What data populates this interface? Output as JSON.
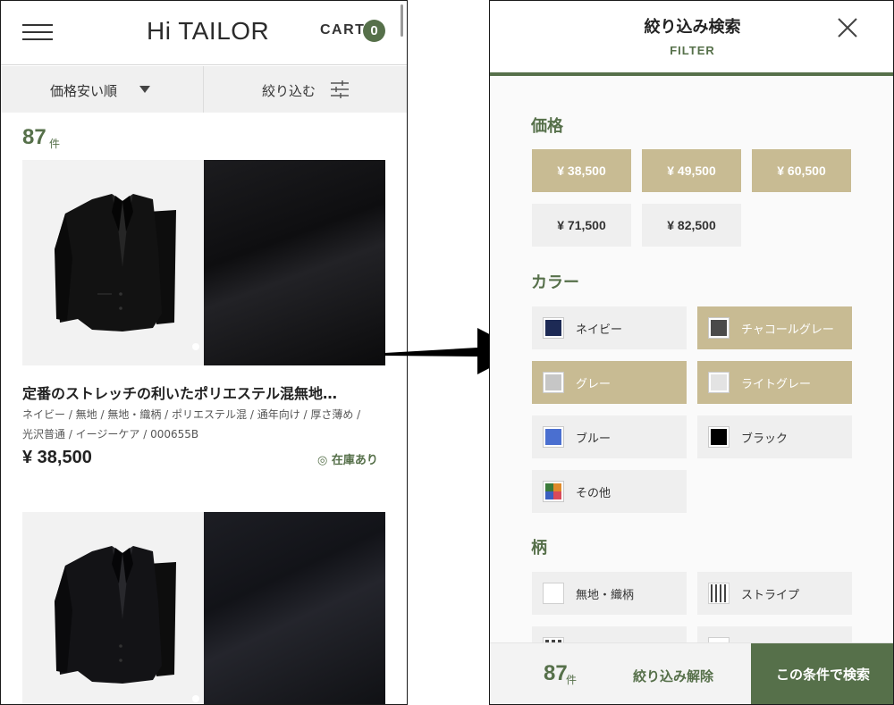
{
  "list_screen": {
    "brand": "Hi TAILOR",
    "cart_label": "CART",
    "cart_count": "0",
    "sort_label": "価格安い順",
    "filter_label": "絞り込む",
    "result_count": "87",
    "result_unit": "件",
    "products": [
      {
        "title": "定番のストレッチの利いたポリエステル混無地…",
        "tags_line1": "ネイビー / 無地 / 無地・織柄 / ポリエステル混 / 通年向け / 厚さ薄め /",
        "tags_line2": "光沢普通 / イージーケア / 000655B",
        "price": "¥ 38,500",
        "stock": "◎ 在庫あり"
      },
      {
        "title": "",
        "tags_line1": "",
        "tags_line2": "",
        "price": "",
        "stock": ""
      }
    ]
  },
  "filter_screen": {
    "title": "絞り込み検索",
    "subtitle": "FILTER",
    "sections": {
      "price": "価格",
      "color": "カラー",
      "pattern": "柄"
    },
    "prices": [
      {
        "label": "¥ 38,500",
        "selected": true
      },
      {
        "label": "¥ 49,500",
        "selected": true
      },
      {
        "label": "¥ 60,500",
        "selected": true
      },
      {
        "label": "¥ 71,500",
        "selected": false
      },
      {
        "label": "¥ 82,500",
        "selected": false
      }
    ],
    "colors": [
      {
        "label": "ネイビー",
        "swatch": "#1d2a55",
        "selected": false
      },
      {
        "label": "チャコールグレー",
        "swatch": "#4a4a4a",
        "selected": true
      },
      {
        "label": "グレー",
        "swatch": "#c6c6c6",
        "selected": true
      },
      {
        "label": "ライトグレー",
        "swatch": "#e3e3e3",
        "selected": true
      },
      {
        "label": "ブルー",
        "swatch": "#4a6fd0",
        "selected": false
      },
      {
        "label": "ブラック",
        "swatch": "#000000",
        "selected": false
      },
      {
        "label": "その他",
        "swatch": "multi",
        "selected": false
      }
    ],
    "other_swatch_colors": [
      "#3a7a3a",
      "#e08a2a",
      "#3a5fc0",
      "#d84a5a"
    ],
    "patterns": [
      {
        "label": "無地・織柄",
        "icon": "plain-icon"
      },
      {
        "label": "ストライプ",
        "icon": "stripe-icon"
      }
    ],
    "footer": {
      "count": "87",
      "unit": "件",
      "clear_label": "絞り込み解除",
      "search_label": "この条件で検索"
    }
  },
  "theme": {
    "accent": "#56704a",
    "selected_chip": "#c8bb93",
    "chip": "#efefef"
  }
}
